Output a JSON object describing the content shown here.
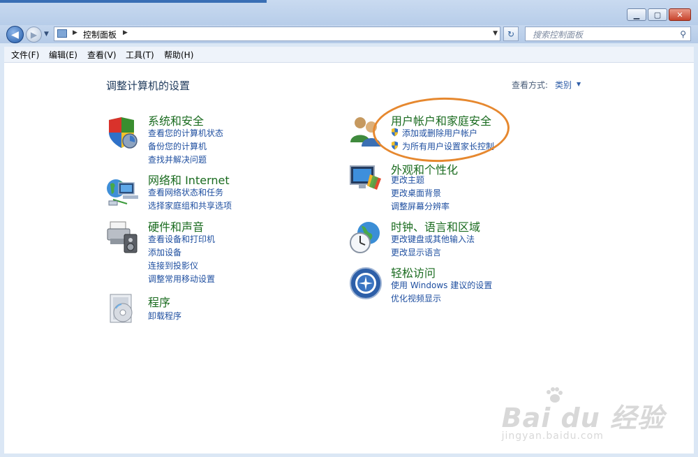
{
  "window": {
    "controls": [
      "minimize",
      "maximize",
      "close"
    ]
  },
  "nav": {
    "address_path": "控制面板",
    "search_placeholder": "搜索控制面板"
  },
  "menubar": {
    "items": [
      "文件(F)",
      "编辑(E)",
      "查看(V)",
      "工具(T)",
      "帮助(H)"
    ]
  },
  "page": {
    "title": "调整计算机的设置",
    "view_by_label": "查看方式:",
    "view_by_value": "类别"
  },
  "categories": {
    "system_security": {
      "title": "系统和安全",
      "links": [
        "查看您的计算机状态",
        "备份您的计算机",
        "查找并解决问题"
      ]
    },
    "network": {
      "title": "网络和 Internet",
      "links": [
        "查看网络状态和任务",
        "选择家庭组和共享选项"
      ]
    },
    "hardware": {
      "title": "硬件和声音",
      "links": [
        "查看设备和打印机",
        "添加设备",
        "连接到投影仪",
        "调整常用移动设置"
      ]
    },
    "programs": {
      "title": "程序",
      "links": [
        "卸载程序"
      ]
    },
    "user_accounts": {
      "title": "用户帐户和家庭安全",
      "links": [
        "添加或删除用户帐户",
        "为所有用户设置家长控制"
      ]
    },
    "appearance": {
      "title": "外观和个性化",
      "links": [
        "更改主题",
        "更改桌面背景",
        "调整屏幕分辨率"
      ]
    },
    "clock": {
      "title": "时钟、语言和区域",
      "links": [
        "更改键盘或其他输入法",
        "更改显示语言"
      ]
    },
    "ease": {
      "title": "轻松访问",
      "links": [
        "使用 Windows 建议的设置",
        "优化视频显示"
      ]
    }
  },
  "watermark": {
    "logo": "Bai du 经验",
    "url": "jingyan.baidu.com"
  },
  "colors": {
    "category_title": "#1a6b1f",
    "link": "#1f4fa0",
    "highlight": "#e6882f"
  }
}
